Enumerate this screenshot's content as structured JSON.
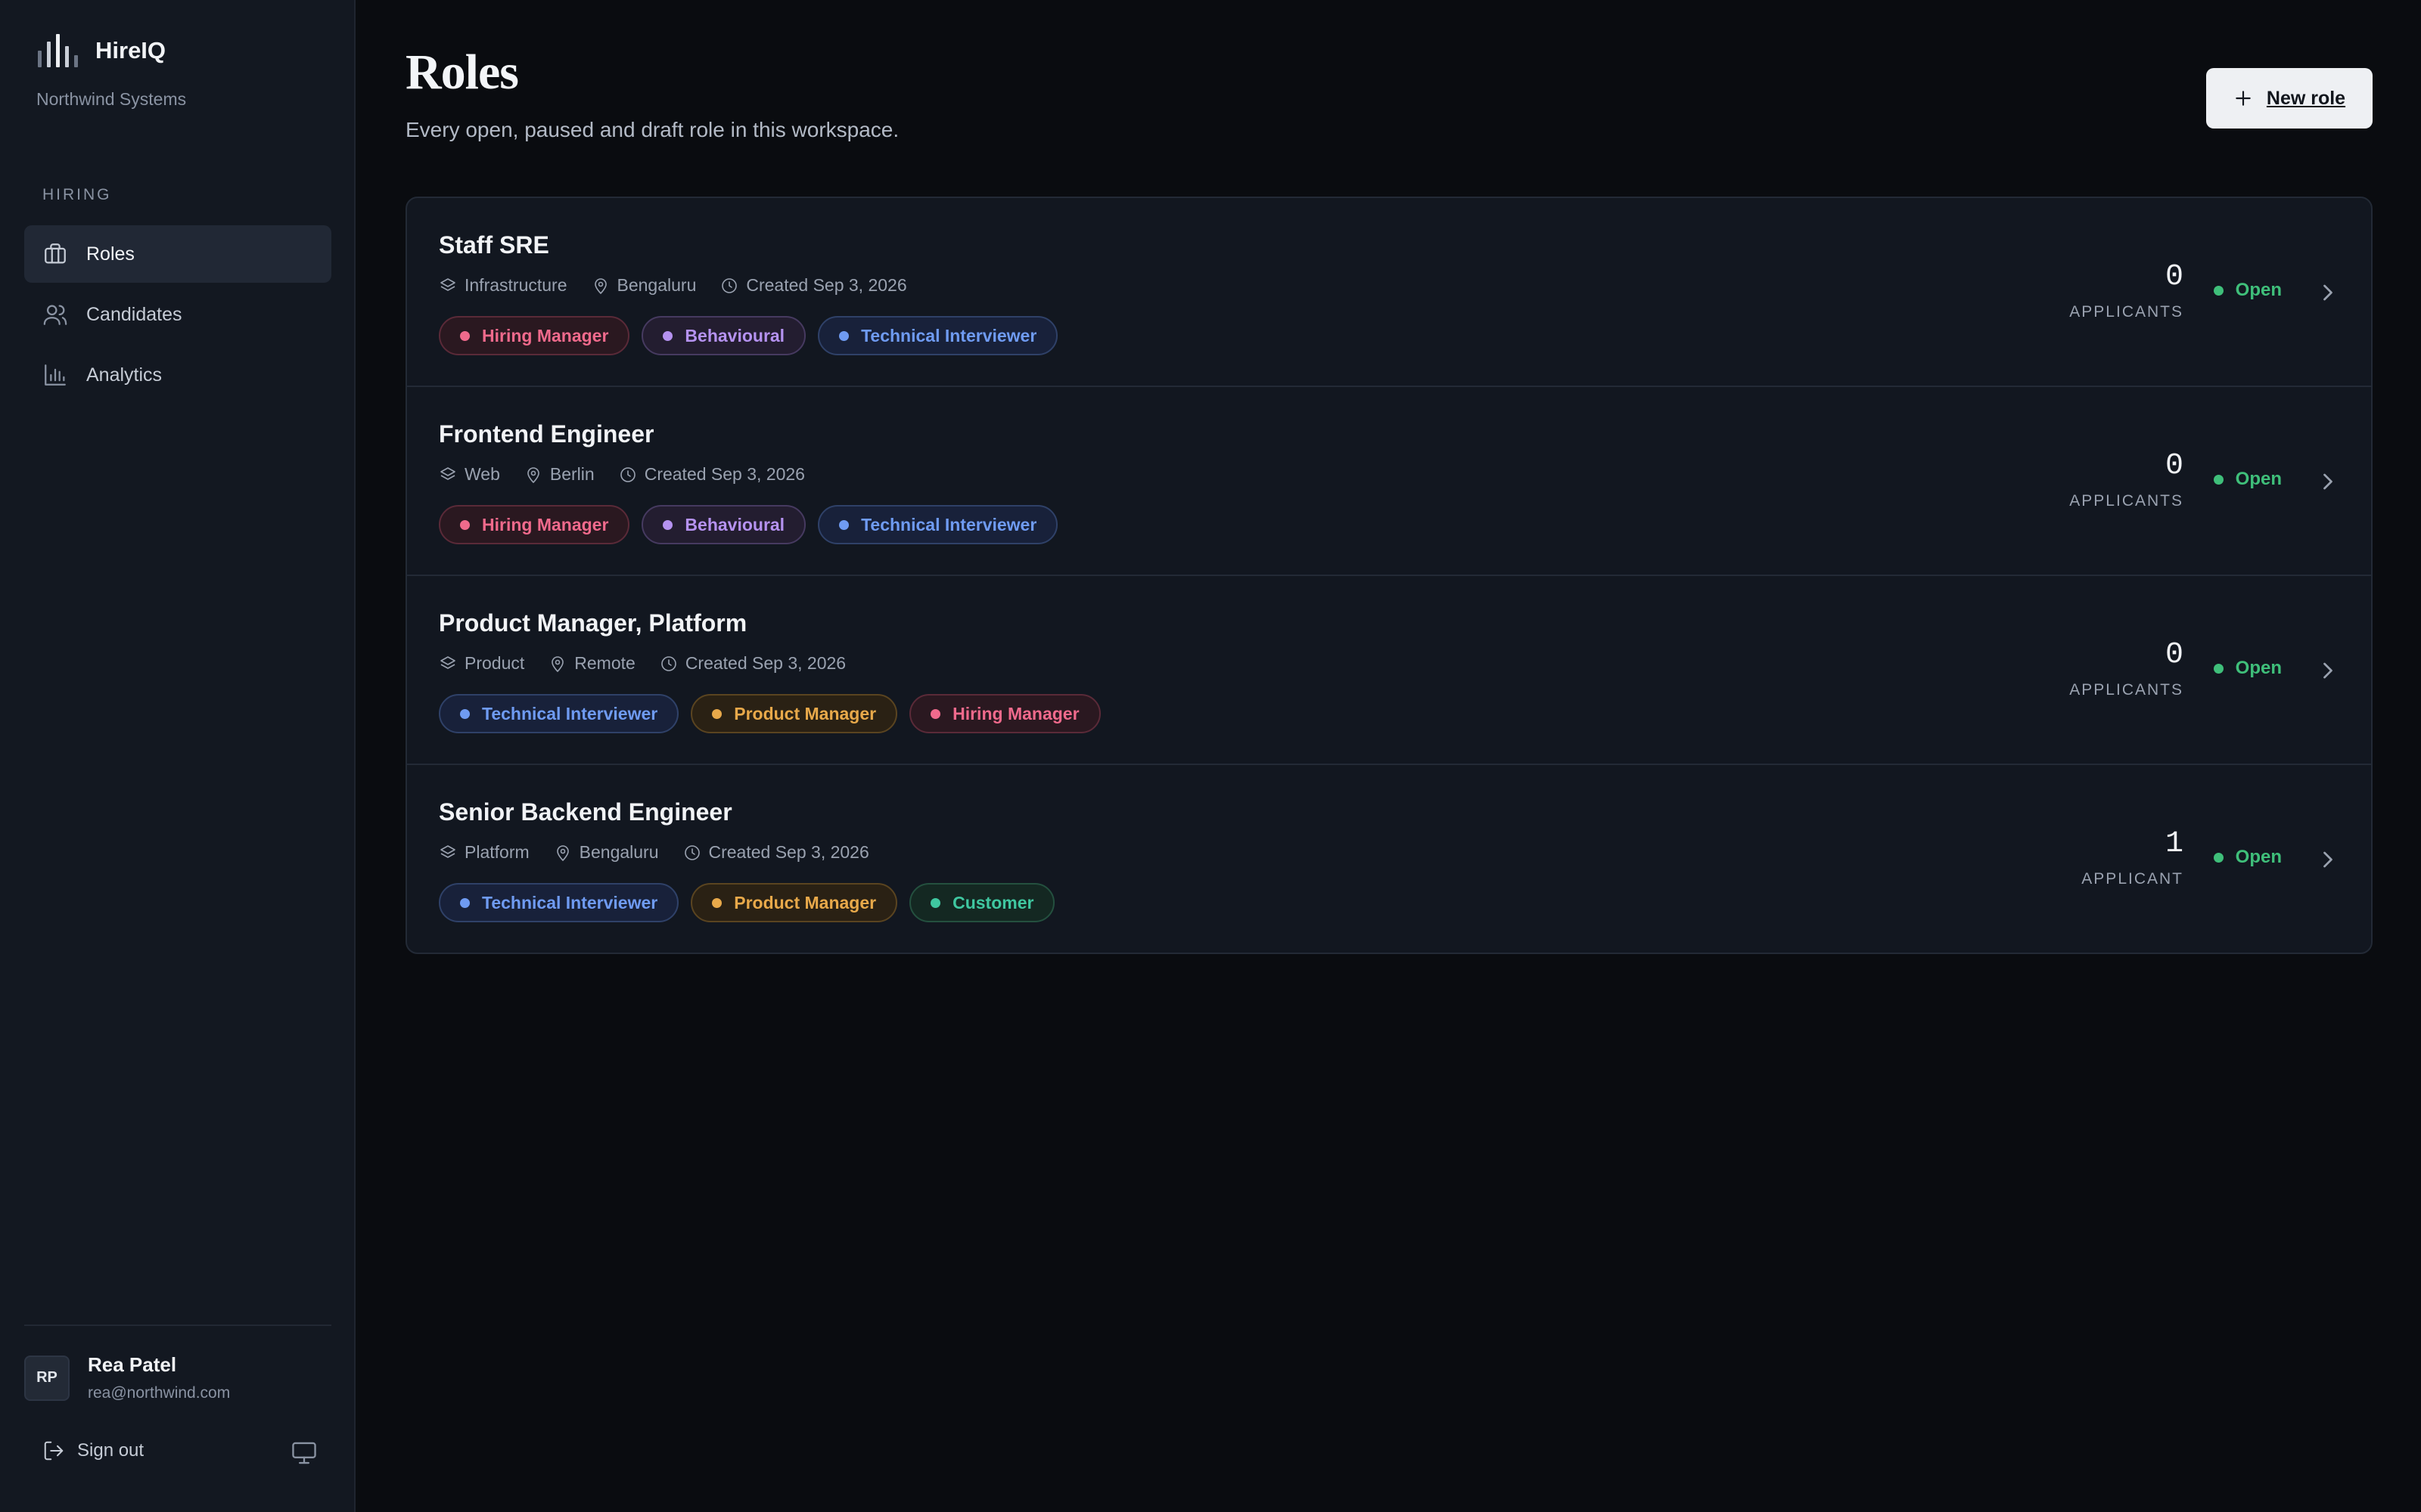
{
  "app": {
    "name": "HireIQ",
    "workspace": "Northwind Systems"
  },
  "sidebar": {
    "section": "HIRING",
    "items": [
      {
        "label": "Roles",
        "icon": "briefcase-icon",
        "active": true
      },
      {
        "label": "Candidates",
        "icon": "users-icon",
        "active": false
      },
      {
        "label": "Analytics",
        "icon": "bar-chart-icon",
        "active": false
      }
    ]
  },
  "user": {
    "initials": "RP",
    "name": "Rea Patel",
    "email": "rea@northwind.com"
  },
  "footer": {
    "signout_label": "Sign out"
  },
  "page": {
    "title": "Roles",
    "subtitle": "Every open, paused and draft role in this workspace.",
    "new_role_label": "New role"
  },
  "colors": {
    "Hiring Manager": {
      "fg": "#f06a8c",
      "bg": "#2a1820",
      "border": "#5a2a38"
    },
    "Behavioural": {
      "fg": "#b592f0",
      "bg": "#231d30",
      "border": "#463a60"
    },
    "Technical Interviewer": {
      "fg": "#6f9bf2",
      "bg": "#18213a",
      "border": "#2f4168"
    },
    "Product Manager": {
      "fg": "#e8a94a",
      "bg": "#2a2114",
      "border": "#5a4420"
    },
    "Customer": {
      "fg": "#3fc7a0",
      "bg": "#142822",
      "border": "#24503f"
    },
    "status_open": "#3fbf7a"
  },
  "roles": [
    {
      "title": "Staff SRE",
      "team": "Infrastructure",
      "location": "Bengaluru",
      "created": "Created Sep 3, 2026",
      "tags": [
        "Hiring Manager",
        "Behavioural",
        "Technical Interviewer"
      ],
      "applicants": "0",
      "applicants_label": "APPLICANTS",
      "status": "Open"
    },
    {
      "title": "Frontend Engineer",
      "team": "Web",
      "location": "Berlin",
      "created": "Created Sep 3, 2026",
      "tags": [
        "Hiring Manager",
        "Behavioural",
        "Technical Interviewer"
      ],
      "applicants": "0",
      "applicants_label": "APPLICANTS",
      "status": "Open"
    },
    {
      "title": "Product Manager, Platform",
      "team": "Product",
      "location": "Remote",
      "created": "Created Sep 3, 2026",
      "tags": [
        "Technical Interviewer",
        "Product Manager",
        "Hiring Manager"
      ],
      "applicants": "0",
      "applicants_label": "APPLICANTS",
      "status": "Open"
    },
    {
      "title": "Senior Backend Engineer",
      "team": "Platform",
      "location": "Bengaluru",
      "created": "Created Sep 3, 2026",
      "tags": [
        "Technical Interviewer",
        "Product Manager",
        "Customer"
      ],
      "applicants": "1",
      "applicants_label": "APPLICANT",
      "status": "Open"
    }
  ]
}
